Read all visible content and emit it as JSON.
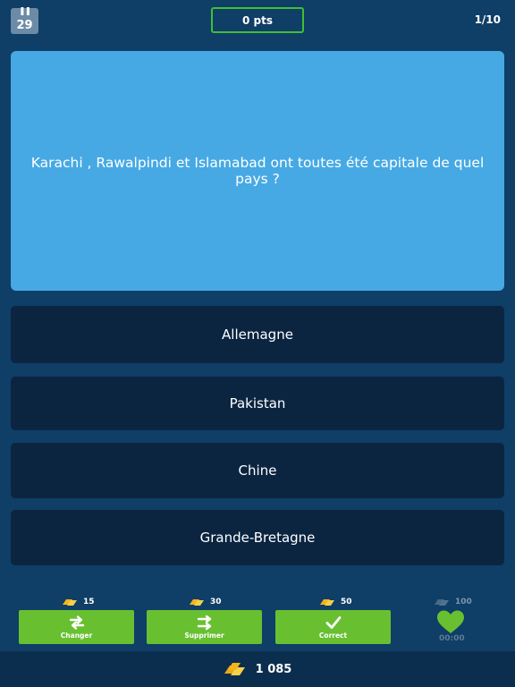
{
  "header": {
    "timer_value": "29",
    "score": "0 pts",
    "progress": "1/10"
  },
  "question": {
    "text": "Karachi , Rawalpindi et Islamabad ont toutes été capitale de quel pays ?"
  },
  "answers": [
    "Allemagne",
    "Pakistan",
    "Chine",
    "Grande-Bretagne"
  ],
  "powerups": [
    {
      "cost": "15",
      "label": "Changer",
      "icon": "swap-arrows-icon"
    },
    {
      "cost": "30",
      "label": "Supprimer",
      "icon": "double-arrow-right-icon"
    },
    {
      "cost": "50",
      "label": "Correct",
      "icon": "checkmark-icon"
    }
  ],
  "life": {
    "cost": "100",
    "timer": "00:00",
    "icon": "heart-icon"
  },
  "footer": {
    "coins": "1 085"
  },
  "colors": {
    "background": "#0f3e66",
    "question_bg": "#46a9e4",
    "answer_bg": "#0b2541",
    "accent_green": "#68c031",
    "score_border": "#3fbf35",
    "coin_gold": "#f3b51b"
  }
}
